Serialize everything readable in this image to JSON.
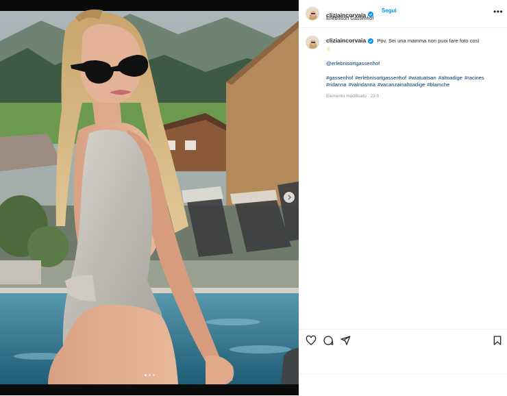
{
  "header": {
    "username": "cliziaincorvaia",
    "follow_label": "Segui",
    "location": "Erlebnisort Gassenhof",
    "more_icon": "ellipsis-icon"
  },
  "caption": {
    "username": "cliziaincorvaia",
    "text": "Pov. Sei una mamma non puoi fare foto così",
    "emoji": "✌",
    "mention": "@erlebnisortgassenhof",
    "hashtags": "#gassenhof #erlebnisortgassenhof #wiatuatsan #altoadige #racines #ridanna #valridanna #vacanzainaltoadige #blamche",
    "meta": "Elemento modificato · 23 h"
  },
  "media": {
    "carousel_position": 1,
    "carousel_total": 3
  },
  "actions": {
    "like_icon": "heart-icon",
    "comment_icon": "comment-icon",
    "share_icon": "share-icon",
    "save_icon": "bookmark-icon"
  },
  "colors": {
    "link": "#00376b",
    "follow": "#0095f6",
    "verified": "#0095f6",
    "meta": "#8e8e8e"
  }
}
